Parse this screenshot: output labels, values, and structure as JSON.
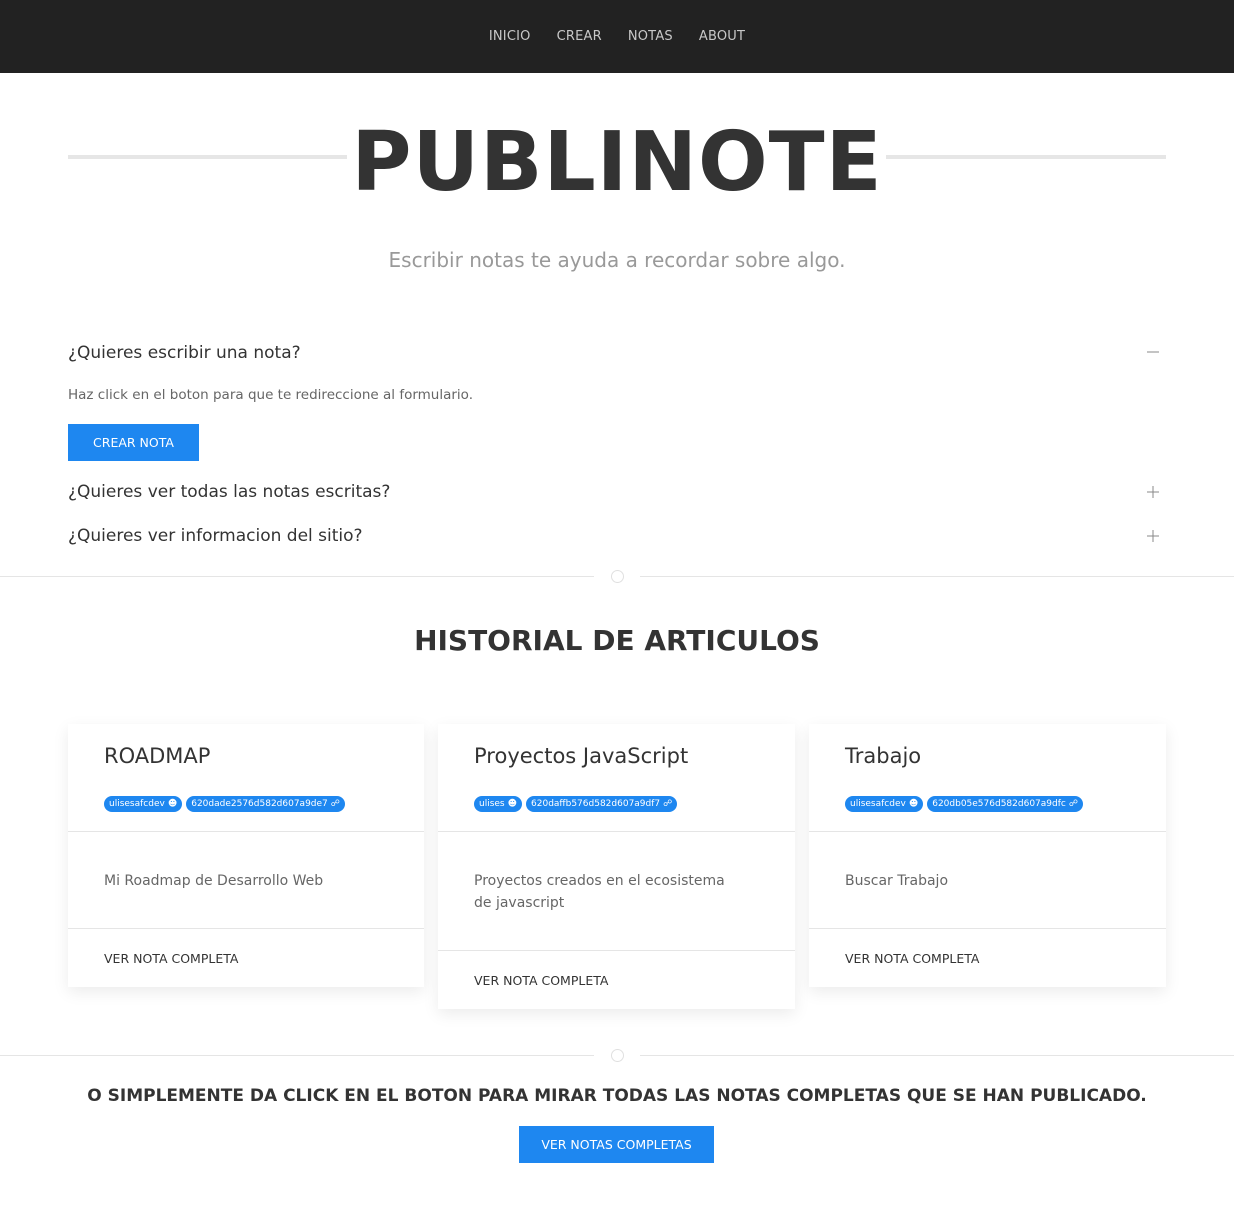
{
  "nav": {
    "items": [
      {
        "label": "INICIO"
      },
      {
        "label": "CREAR"
      },
      {
        "label": "NOTAS"
      },
      {
        "label": "ABOUT"
      }
    ]
  },
  "hero": {
    "title": "PUBLINOTE",
    "subtitle": "Escribir notas te ayuda a recordar sobre algo."
  },
  "accordion": {
    "items": [
      {
        "title": "¿Quieres escribir una nota?",
        "icon": "minus-icon",
        "text": "Haz click en el boton para que te redireccione al formulario.",
        "button": "CREAR NOTA"
      },
      {
        "title": "¿Quieres ver todas las notas escritas?",
        "icon": "plus-icon"
      },
      {
        "title": "¿Quieres ver informacion del sitio?",
        "icon": "plus-icon"
      }
    ]
  },
  "history": {
    "title": "HISTORIAL DE ARTICULOS",
    "cards": [
      {
        "title": "ROADMAP",
        "author": "ulisesafcdev",
        "id": "620dade2576d582d607a9de7",
        "description": "Mi Roadmap de Desarrollo Web",
        "link": "VER NOTA COMPLETA"
      },
      {
        "title": "Proyectos JavaScript",
        "author": "ulises",
        "id": "620daffb576d582d607a9df7",
        "description": "Proyectos creados en el ecosistema de javascript",
        "link": "VER NOTA COMPLETA"
      },
      {
        "title": "Trabajo",
        "author": "ulisesafcdev",
        "id": "620db05e576d582d607a9dfc",
        "description": "Buscar Trabajo",
        "link": "VER NOTA COMPLETA"
      }
    ]
  },
  "footer_cta": {
    "text": "O SIMPLEMENTE DA CLICK EN EL BOTON PARA MIRAR TODAS LAS NOTAS COMPLETAS QUE SE HAN PUBLICADO.",
    "button": "VER NOTAS COMPLETAS"
  },
  "colors": {
    "primary": "#1e87f0",
    "navbar": "#222222",
    "text": "#333333",
    "muted": "#999999"
  }
}
